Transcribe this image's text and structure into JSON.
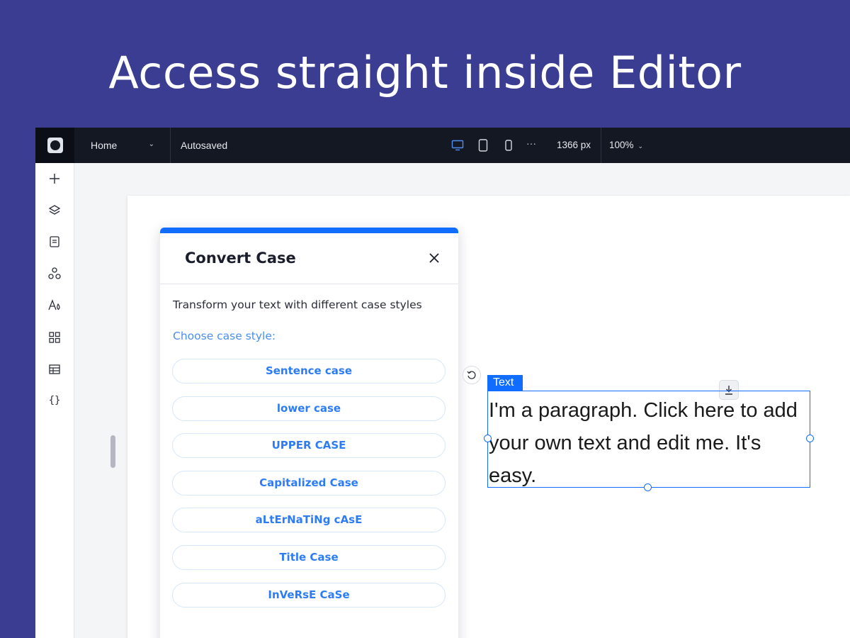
{
  "headline": "Access straight inside Editor",
  "topbar": {
    "logo_icon": "wix-studio-logo-icon",
    "page_select_value": "Home",
    "autosaved_label": "Autosaved",
    "devices": [
      "desktop-icon",
      "tablet-icon",
      "mobile-icon"
    ],
    "more_label": "···",
    "canvas_width": "1366 px",
    "zoom_value": "100%"
  },
  "leftbar": {
    "icons": [
      "add-icon",
      "layers-icon",
      "pages-icon",
      "apps-icon",
      "design-icon",
      "widgets-icon",
      "cms-table-icon",
      "code-icon"
    ]
  },
  "panel": {
    "title": "Convert Case",
    "description": "Transform your text with different case styles",
    "choose_label": "Choose case style:",
    "options": [
      "Sentence case",
      "lower case",
      "UPPER CASE",
      "Capitalized Case",
      "aLtErNaTiNg cAsE",
      "Title Case",
      "InVeRsE CaSe"
    ]
  },
  "text_element": {
    "tag_label": "Text",
    "content": "I'm a paragraph. Click here to add your own text and edit me. It's easy."
  },
  "colors": {
    "background": "#3a3d91",
    "topbar": "#141823",
    "accent": "#116dff",
    "option_text": "#2d7cf6"
  }
}
